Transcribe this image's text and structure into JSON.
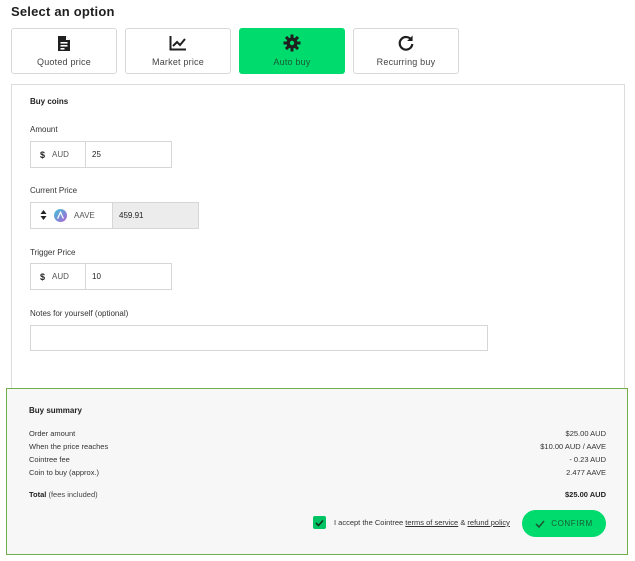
{
  "header": {
    "title": "Select an option"
  },
  "options": [
    {
      "label": "Quoted price",
      "icon": "document-icon"
    },
    {
      "label": "Market price",
      "icon": "chart-line-icon"
    },
    {
      "label": "Auto buy",
      "icon": "gear-icon",
      "active": true
    },
    {
      "label": "Recurring buy",
      "icon": "refresh-icon"
    }
  ],
  "buy": {
    "section_title": "Buy coins",
    "amount": {
      "label": "Amount",
      "symbol": "$",
      "currency": "AUD",
      "value": "25"
    },
    "current_price": {
      "label": "Current Price",
      "coin": "AAVE",
      "value": "459.91"
    },
    "trigger_price": {
      "label": "Trigger Price",
      "symbol": "$",
      "currency": "AUD",
      "value": "10"
    },
    "notes": {
      "label": "Notes for yourself (optional)",
      "value": ""
    }
  },
  "summary": {
    "title": "Buy summary",
    "rows": [
      {
        "label": "Order amount",
        "value": "$25.00 AUD"
      },
      {
        "label": "When the price reaches",
        "value": "$10.00 AUD / AAVE"
      },
      {
        "label": "Cointree fee",
        "value": "- 0.23 AUD"
      },
      {
        "label": "Coin to buy (approx.)",
        "value": "2.477 AAVE"
      }
    ],
    "total_label": "Total",
    "total_note": "(fees included)",
    "total_value": "$25.00 AUD",
    "accept_prefix": "I accept the Cointree ",
    "terms_link": "terms of service",
    "amp": " & ",
    "refund_link": "refund policy",
    "confirm_label": "CONFIRM",
    "accepted": true
  },
  "colors": {
    "accent": "#00db6d",
    "summary_border": "#6fae4a",
    "coin": "#7b6ad9"
  }
}
